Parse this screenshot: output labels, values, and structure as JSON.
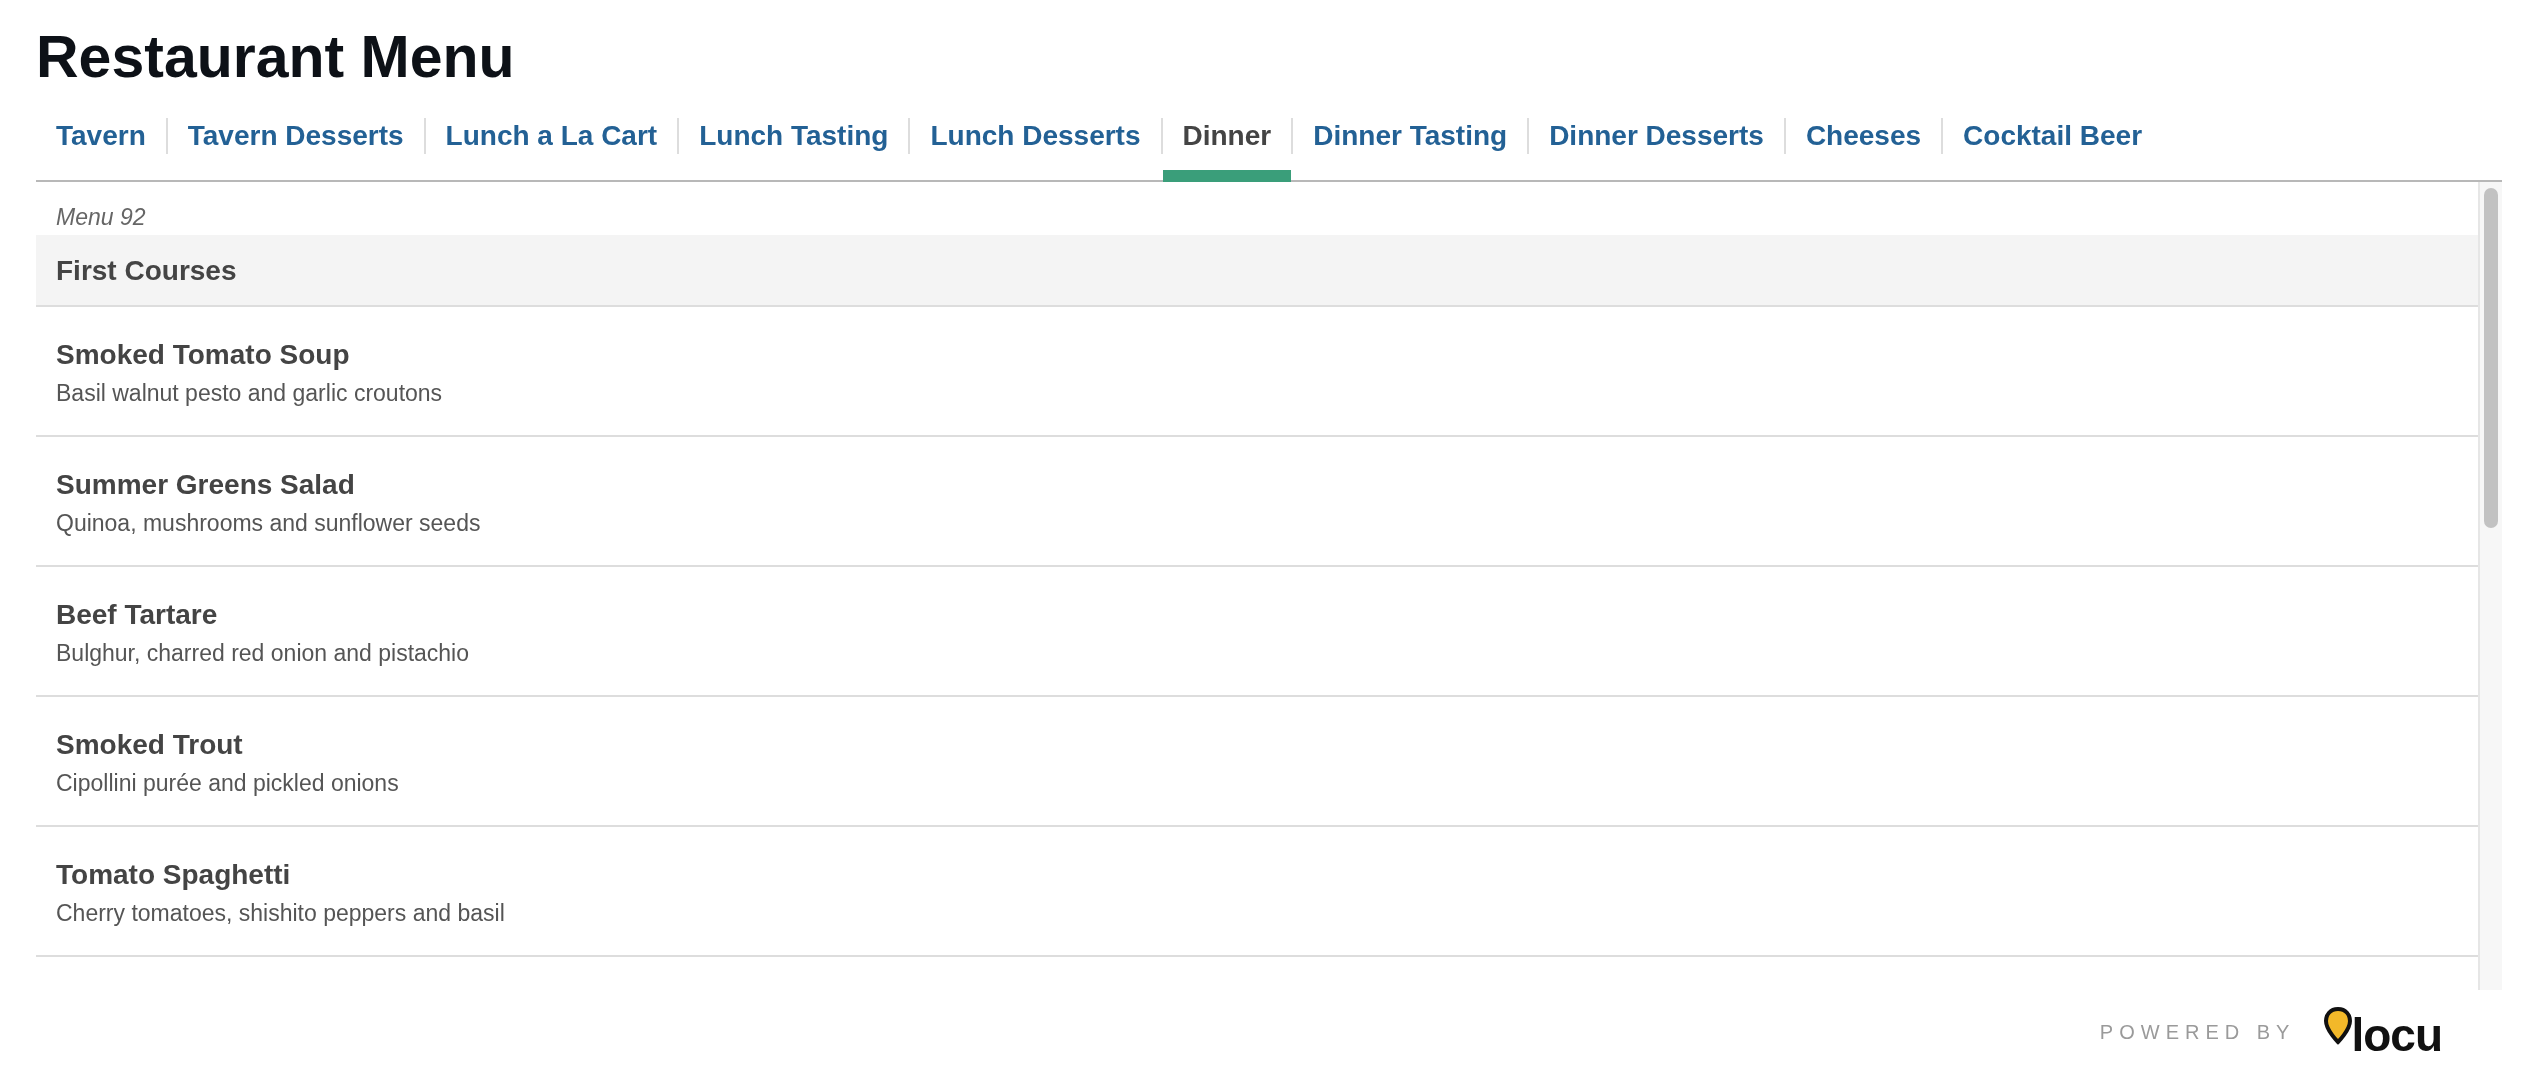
{
  "title": "Restaurant Menu",
  "tabs": [
    {
      "label": "Tavern",
      "selected": false
    },
    {
      "label": "Tavern Desserts",
      "selected": false
    },
    {
      "label": "Lunch a La Cart",
      "selected": false
    },
    {
      "label": "Lunch Tasting",
      "selected": false
    },
    {
      "label": "Lunch Desserts",
      "selected": false
    },
    {
      "label": "Dinner",
      "selected": true
    },
    {
      "label": "Dinner Tasting",
      "selected": false
    },
    {
      "label": "Dinner Desserts",
      "selected": false
    },
    {
      "label": "Cheeses",
      "selected": false
    },
    {
      "label": "Cocktail Beer",
      "selected": false
    }
  ],
  "menu_label": "Menu 92",
  "section": {
    "title": "First Courses",
    "items": [
      {
        "name": "Smoked Tomato Soup",
        "description": "Basil walnut pesto and garlic croutons"
      },
      {
        "name": "Summer Greens Salad",
        "description": "Quinoa, mushrooms and sunflower seeds"
      },
      {
        "name": "Beef Tartare",
        "description": "Bulghur, charred red onion and pistachio"
      },
      {
        "name": "Smoked Trout",
        "description": "Cipollini purée and pickled onions"
      },
      {
        "name": "Tomato Spaghetti",
        "description": "Cherry tomatoes, shishito peppers and basil"
      }
    ]
  },
  "footer": {
    "powered_by": "POWERED BY",
    "logo": "locu"
  }
}
